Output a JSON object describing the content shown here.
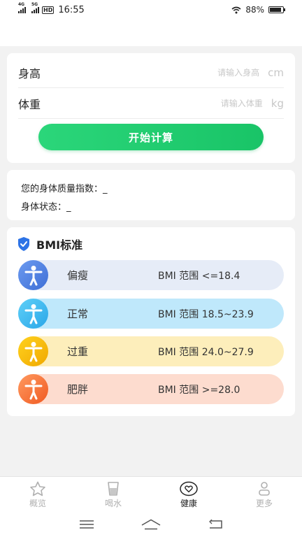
{
  "status_bar": {
    "net1": "4G",
    "net2": "5G",
    "hd": "HD",
    "time": "16:55",
    "battery_text": "88%",
    "battery_level": 0.88
  },
  "form": {
    "height_label": "身高",
    "height_placeholder": "请输入身高",
    "height_unit": "cm",
    "weight_label": "体重",
    "weight_placeholder": "请输入体重",
    "weight_unit": "kg",
    "calc_button": "开始计算"
  },
  "result": {
    "bmi_label": "您的身体质量指数：",
    "bmi_value": "_",
    "state_label": "身体状态：",
    "state_value": "_"
  },
  "standard": {
    "title": "BMI标准",
    "items": [
      {
        "name": "偏瘦",
        "range": "BMI 范围 <=18.4",
        "color": "#4a7de0"
      },
      {
        "name": "正常",
        "range": "BMI 范围 18.5~23.9",
        "color": "#3bb5ef"
      },
      {
        "name": "过重",
        "range": "BMI 范围 24.0~27.9",
        "color": "#f5b800"
      },
      {
        "name": "肥胖",
        "range": "BMI 范围 >=28.0",
        "color": "#f26a30"
      }
    ]
  },
  "tabs": [
    {
      "label": "概览",
      "icon": "star-icon",
      "active": false
    },
    {
      "label": "喝水",
      "icon": "cup-icon",
      "active": false
    },
    {
      "label": "健康",
      "icon": "heart-icon",
      "active": true
    },
    {
      "label": "更多",
      "icon": "person-icon",
      "active": false
    }
  ],
  "colors": {
    "accent_green": "#1fcc6f",
    "background": "#f2f2f2"
  }
}
